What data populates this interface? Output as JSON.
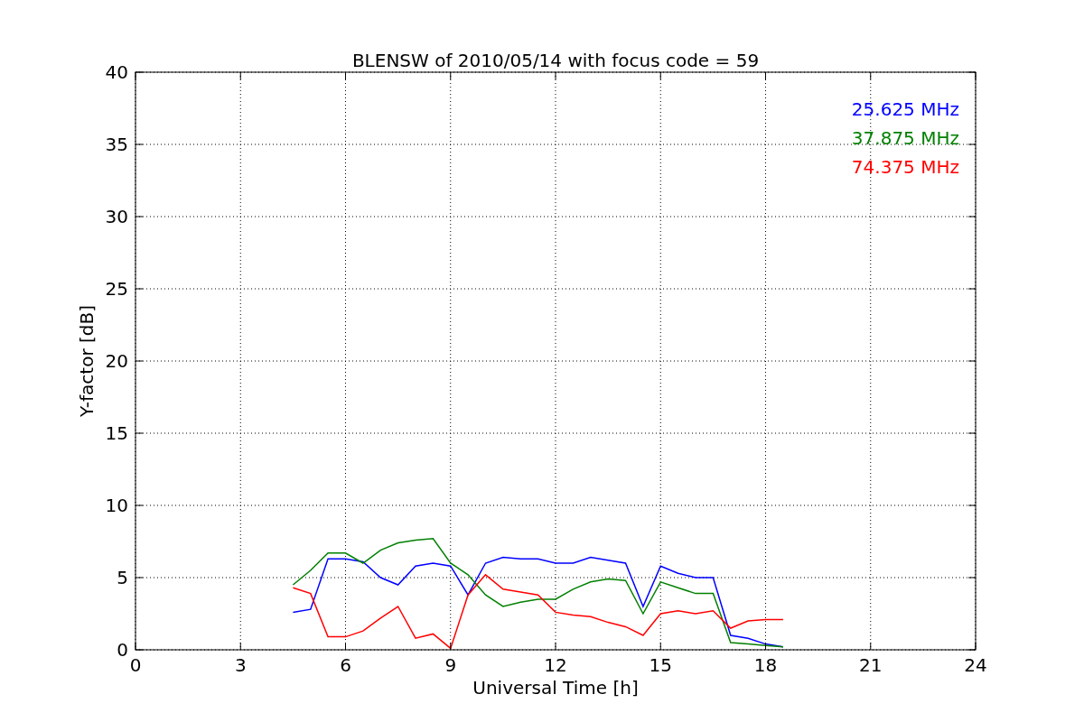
{
  "chart_data": {
    "type": "line",
    "title": "BLENSW of 2010/05/14 with focus code = 59",
    "xlabel": "Universal Time [h]",
    "ylabel": "Y-factor [dB]",
    "x": [
      4.5,
      5,
      5.5,
      6,
      6.5,
      7,
      7.5,
      8,
      8.5,
      9,
      9.5,
      10,
      10.5,
      11,
      11.5,
      12,
      12.5,
      13,
      13.5,
      14,
      14.5,
      15,
      15.5,
      16,
      16.5,
      17,
      17.5,
      18,
      18.5
    ],
    "series": [
      {
        "name": "25.625 MHz",
        "color": "#0000ff",
        "values": [
          2.6,
          2.8,
          6.3,
          6.3,
          6.1,
          5.0,
          4.5,
          5.8,
          6.0,
          5.8,
          3.8,
          6.0,
          6.4,
          6.3,
          6.3,
          6.0,
          6.0,
          6.4,
          6.2,
          6.0,
          3.0,
          5.8,
          5.3,
          5.0,
          5.0,
          1.0,
          0.8,
          0.4,
          0.2
        ]
      },
      {
        "name": "37.875 MHz",
        "color": "#008000",
        "values": [
          4.5,
          5.5,
          6.7,
          6.7,
          6.0,
          6.9,
          7.4,
          7.6,
          7.7,
          6.0,
          5.2,
          3.8,
          3.0,
          3.3,
          3.5,
          3.5,
          4.2,
          4.7,
          4.9,
          4.8,
          2.5,
          4.7,
          4.3,
          3.9,
          3.9,
          0.5,
          0.4,
          0.3,
          0.2
        ]
      },
      {
        "name": "74.375 MHz",
        "color": "#ff0000",
        "values": [
          4.3,
          3.9,
          0.9,
          0.9,
          1.3,
          2.2,
          3.0,
          0.8,
          1.1,
          0.1,
          3.8,
          5.2,
          4.2,
          4.0,
          3.8,
          2.6,
          2.4,
          2.3,
          1.9,
          1.6,
          1.0,
          2.5,
          2.7,
          2.5,
          2.7,
          1.5,
          2.0,
          2.1,
          2.1
        ]
      }
    ],
    "grid": true,
    "xlim": [
      0,
      24
    ],
    "ylim": [
      0,
      40
    ],
    "xticks": [
      0,
      3,
      6,
      9,
      12,
      15,
      18,
      21,
      24
    ],
    "yticks": [
      0,
      5,
      10,
      15,
      20,
      25,
      30,
      35,
      40
    ]
  }
}
